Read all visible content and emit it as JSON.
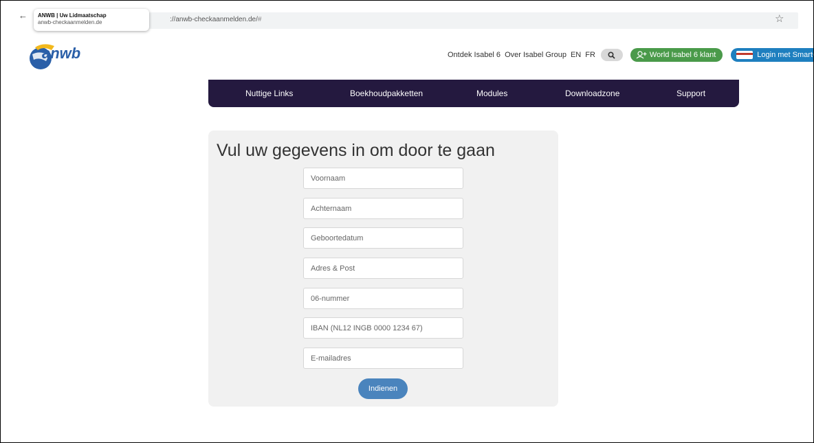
{
  "browser": {
    "tab_title": "ANWB | Uw Lidmaatschap",
    "tab_domain": "anwb-checkaanmelden.de",
    "url_main": "://anwb-checkaanmelden.de/",
    "url_hash": "#"
  },
  "logo": {
    "text": "anwb"
  },
  "topnav": {
    "ontdek": "Ontdek Isabel 6",
    "over": "Over Isabel Group",
    "en": "EN",
    "fr": "FR",
    "world_button": "World Isabel 6 klant",
    "login_button": "Login met SmartCa"
  },
  "mainnav": {
    "items": [
      "Nuttige Links",
      "Boekhoudpakketten",
      "Modules",
      "Downloadzone",
      "Support"
    ],
    "color": "#24193f"
  },
  "form": {
    "title": "Vul uw gegevens in om door te gaan",
    "fields": [
      {
        "placeholder": "Voornaam",
        "value": ""
      },
      {
        "placeholder": "Achternaam",
        "value": ""
      },
      {
        "placeholder": "Geboortedatum",
        "value": ""
      },
      {
        "placeholder": "Adres & Post",
        "value": ""
      },
      {
        "placeholder": "06-nummer",
        "value": ""
      },
      {
        "placeholder": "IBAN (NL12 INGB 0000 1234 67)",
        "value": ""
      },
      {
        "placeholder": "E-mailadres",
        "value": ""
      }
    ],
    "submit_label": "Indienen"
  },
  "colors": {
    "accent_blue": "#4a84bd",
    "green_button": "#4a9a4a",
    "blue_button": "#1e7fbf",
    "logo_blue": "#2a5fa8",
    "logo_yellow": "#f2b81c"
  }
}
